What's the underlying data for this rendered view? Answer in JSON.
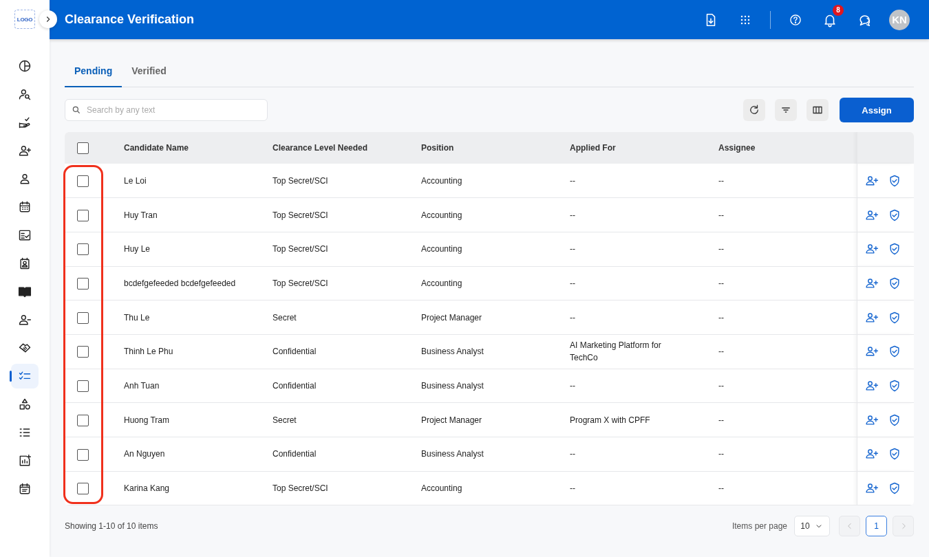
{
  "logo": "LOGO",
  "header": {
    "title": "Clearance Verification",
    "notification_count": "8",
    "avatar": "KN"
  },
  "sidebar": {
    "items": [
      {
        "selected": false
      },
      {
        "selected": false
      },
      {
        "selected": false
      },
      {
        "selected": false
      },
      {
        "selected": false
      },
      {
        "selected": false
      },
      {
        "selected": false
      },
      {
        "selected": false
      },
      {
        "selected": false
      },
      {
        "selected": false
      },
      {
        "selected": false
      },
      {
        "selected": true
      },
      {
        "selected": false
      },
      {
        "selected": false
      },
      {
        "selected": false
      },
      {
        "selected": false
      }
    ]
  },
  "tabs": [
    {
      "label": "Pending",
      "selected": true
    },
    {
      "label": "Verified",
      "selected": false
    }
  ],
  "search": {
    "placeholder": "Search by any text"
  },
  "assign_button": "Assign",
  "table": {
    "header_checked": false,
    "columns": [
      "Candidate Name",
      "Clearance Level Needed",
      "Position",
      "Applied For",
      "Assignee"
    ],
    "rows": [
      {
        "checked": false,
        "cells": [
          "Le Loi",
          "Top Secret/SCI",
          "Accounting",
          "--",
          "--"
        ]
      },
      {
        "checked": false,
        "cells": [
          "Huy Tran",
          "Top Secret/SCI",
          "Accounting",
          "--",
          "--"
        ]
      },
      {
        "checked": false,
        "cells": [
          "Huy Le",
          "Top Secret/SCI",
          "Accounting",
          "--",
          "--"
        ]
      },
      {
        "checked": false,
        "cells": [
          "bcdefgefeeded bcdefgefeeded",
          "Top Secret/SCI",
          "Accounting",
          "--",
          "--"
        ]
      },
      {
        "checked": false,
        "cells": [
          "Thu Le",
          "Secret",
          "Project Manager",
          "--",
          "--"
        ]
      },
      {
        "checked": false,
        "cells": [
          "Thinh Le Phu",
          "Confidential",
          "Business Analyst",
          "AI Marketing Platform for TechCo",
          "--"
        ]
      },
      {
        "checked": false,
        "cells": [
          "Anh Tuan",
          "Confidential",
          "Business Analyst",
          "--",
          "--"
        ]
      },
      {
        "checked": false,
        "cells": [
          "Huong Tram",
          "Secret",
          "Project Manager",
          "Program X with CPFF",
          "--"
        ]
      },
      {
        "checked": false,
        "cells": [
          "An Nguyen",
          "Confidential",
          "Business Analyst",
          "--",
          "--"
        ]
      },
      {
        "checked": false,
        "cells": [
          "Karina Kang",
          "Top Secret/SCI",
          "Accounting",
          "--",
          "--"
        ]
      }
    ]
  },
  "footer": {
    "summary": "Showing 1-10 of 10 items",
    "per_page_label": "Items per page",
    "per_page": "10",
    "pages": [
      {
        "label": "1",
        "selected": true
      }
    ]
  }
}
